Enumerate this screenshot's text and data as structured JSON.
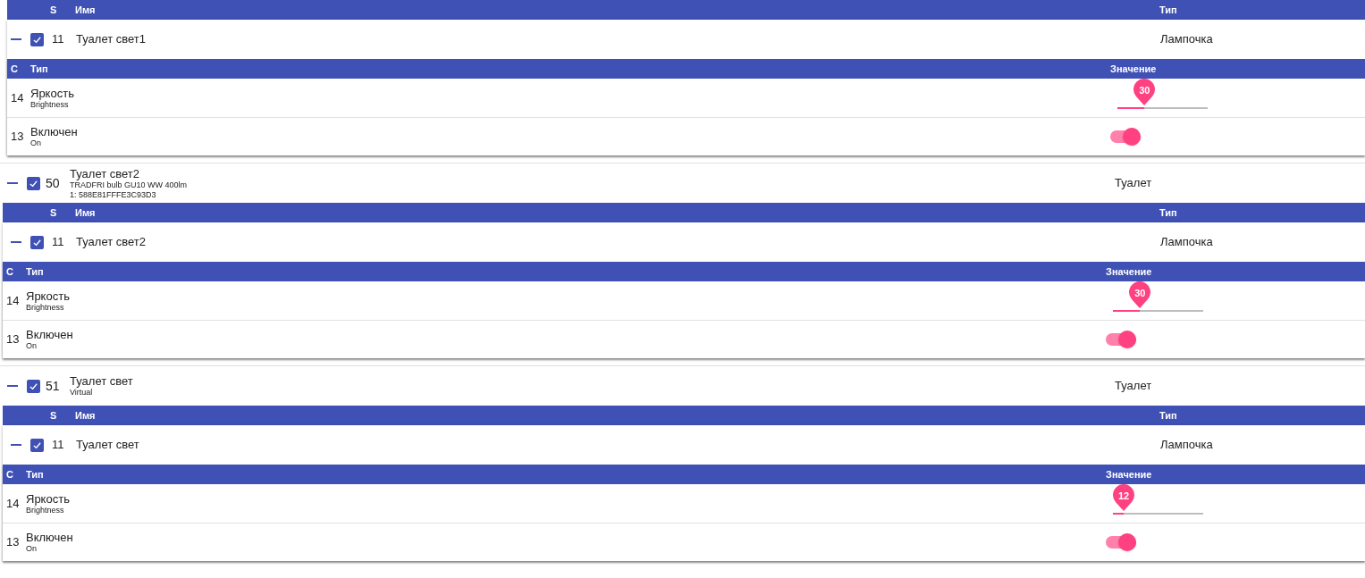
{
  "groups": [
    {
      "columns": {
        "s": "S",
        "name": "Имя",
        "type": "Тип"
      },
      "child": {
        "expanded": true,
        "checked": true,
        "id": "11",
        "name": "Туалет свет1",
        "type": "Лампочка"
      },
      "param_columns": {
        "c": "С",
        "type": "Тип",
        "value": "Значение"
      },
      "params": [
        {
          "kind": "slider",
          "id": "14",
          "name": "Яркость",
          "subtitle": "Brightness",
          "level": 0.3,
          "reading": "30"
        },
        {
          "kind": "toggle",
          "id": "13",
          "name": "Включен",
          "subtitle": "On",
          "on": true
        }
      ]
    },
    {
      "device": {
        "expanded": true,
        "checked": true,
        "id": "50",
        "name": "Туалет свет2",
        "subtitles": [
          "TRADFRI bulb GU10 WW 400lm",
          "1: 588E81FFFE3C93D3"
        ],
        "room": "Туалет"
      },
      "columns": {
        "s": "S",
        "name": "Имя",
        "type": "Тип"
      },
      "child": {
        "expanded": true,
        "checked": true,
        "id": "11",
        "name": "Туалет свет2",
        "type": "Лампочка"
      },
      "param_columns": {
        "c": "С",
        "type": "Тип",
        "value": "Значение"
      },
      "params": [
        {
          "kind": "slider",
          "id": "14",
          "name": "Яркость",
          "subtitle": "Brightness",
          "level": 0.3,
          "reading": "30"
        },
        {
          "kind": "toggle",
          "id": "13",
          "name": "Включен",
          "subtitle": "On",
          "on": true
        }
      ]
    },
    {
      "device": {
        "expanded": true,
        "checked": true,
        "id": "51",
        "name": "Туалет свет",
        "subtitles": [
          "Virtual"
        ],
        "room": "Туалет"
      },
      "columns": {
        "s": "S",
        "name": "Имя",
        "type": "Тип"
      },
      "child": {
        "expanded": true,
        "checked": true,
        "id": "11",
        "name": "Туалет свет",
        "type": "Лампочка"
      },
      "param_columns": {
        "c": "С",
        "type": "Тип",
        "value": "Значение"
      },
      "params": [
        {
          "kind": "slider",
          "id": "14",
          "name": "Яркость",
          "subtitle": "Brightness",
          "level": 0.12,
          "reading": "12"
        },
        {
          "kind": "toggle",
          "id": "13",
          "name": "Включен",
          "subtitle": "On",
          "on": true
        }
      ]
    }
  ]
}
